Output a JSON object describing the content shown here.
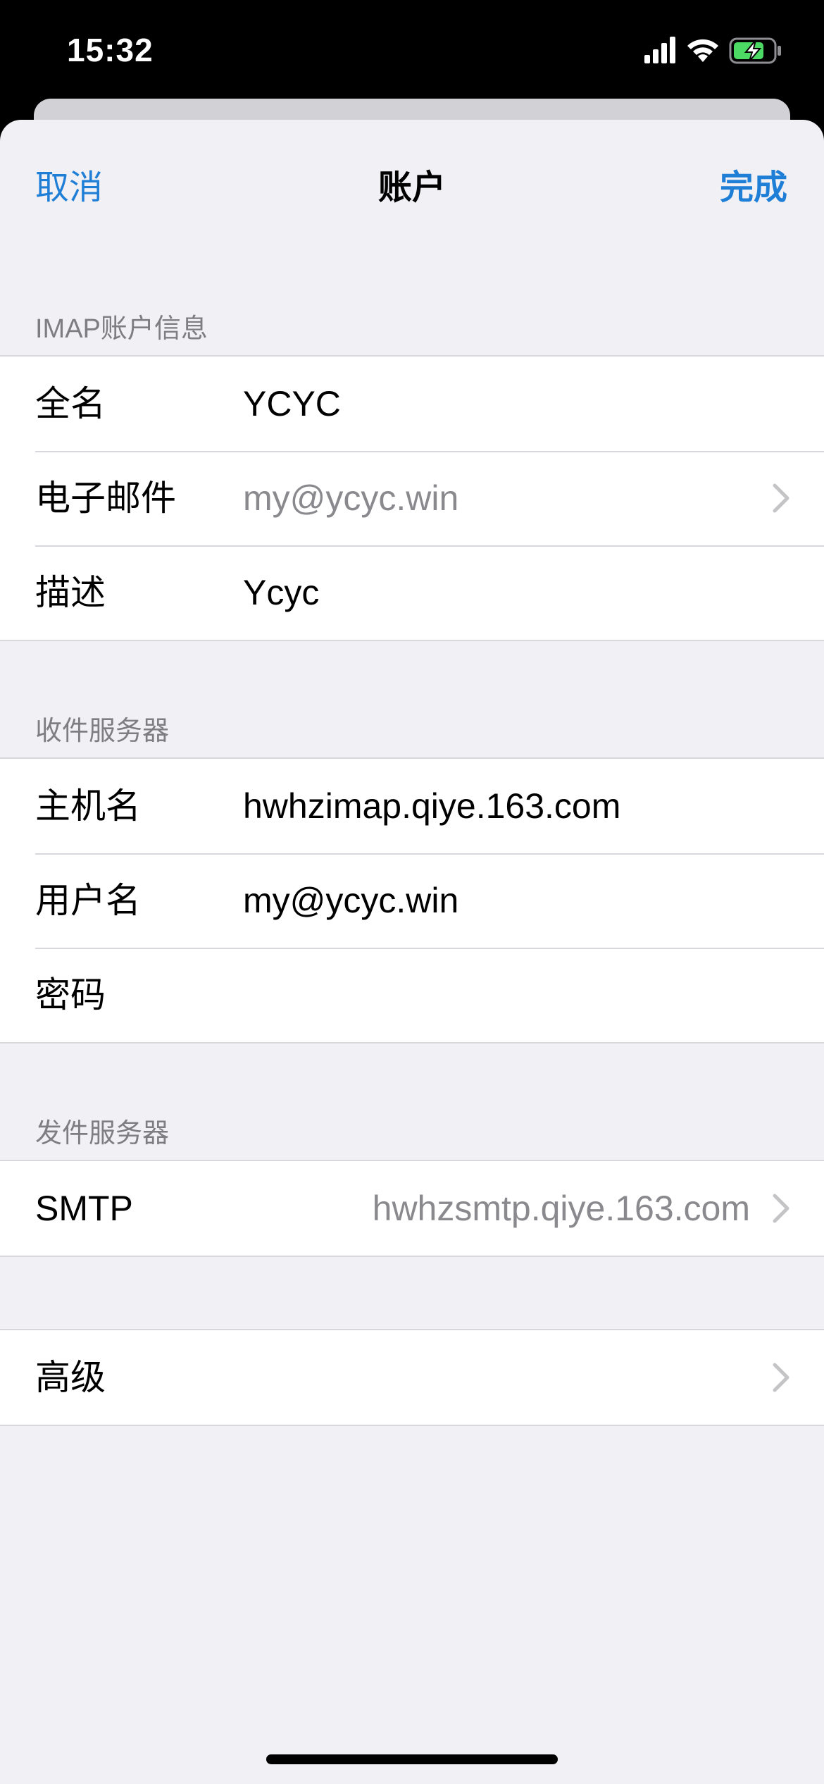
{
  "status_bar": {
    "time": "15:32"
  },
  "nav": {
    "cancel_label": "取消",
    "title": "账户",
    "done_label": "完成",
    "accent_color": "#1f7ed6"
  },
  "imap_section": {
    "header": "IMAP账户信息",
    "rows": [
      {
        "label": "全名",
        "value": "YCYC"
      },
      {
        "label": "电子邮件",
        "value": "my@ycyc.win"
      },
      {
        "label": "描述",
        "value": "Ycyc"
      }
    ]
  },
  "incoming_section": {
    "header": "收件服务器",
    "rows": [
      {
        "label": "主机名",
        "value": "hwhzimap.qiye.163.com"
      },
      {
        "label": "用户名",
        "value": "my@ycyc.win"
      },
      {
        "label": "密码",
        "value": ""
      }
    ]
  },
  "outgoing_section": {
    "header": "发件服务器",
    "rows": [
      {
        "label": "SMTP",
        "value": "hwhzsmtp.qiye.163.com"
      }
    ]
  },
  "advanced_section": {
    "rows": [
      {
        "label": "高级"
      }
    ]
  },
  "icons": {
    "signal": "cellular-signal-icon",
    "wifi": "wifi-icon",
    "battery": "battery-charging-icon",
    "chevron": "chevron-right-icon"
  }
}
